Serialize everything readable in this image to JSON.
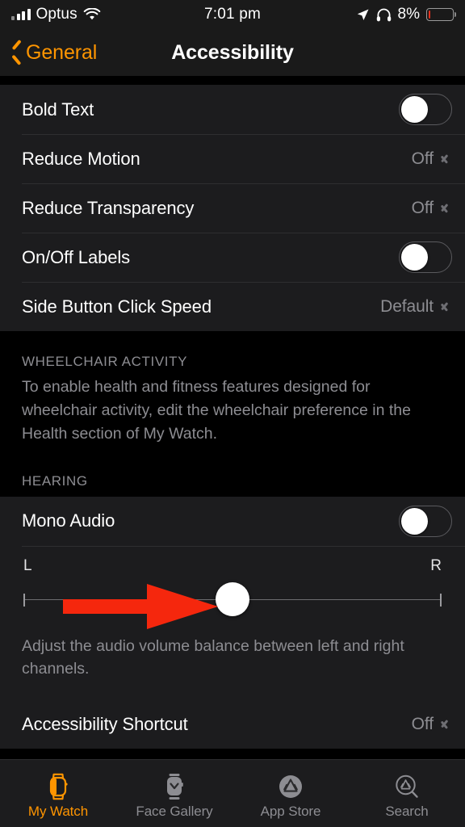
{
  "status_bar": {
    "carrier": "Optus",
    "wifi_icon": "wifi-icon",
    "signal_icon": "cellular-signal-icon",
    "time": "7:01 pm",
    "location_icon": "location-arrow-icon",
    "headphones_icon": "headphones-icon",
    "battery_percent": "8%",
    "battery_level": 8,
    "battery_color": "#e8301c"
  },
  "nav_bar": {
    "back_label": "General",
    "back_icon": "chevron-left-icon",
    "title": "Accessibility",
    "accent_color": "#ff9500"
  },
  "vision_group": {
    "rows": [
      {
        "label": "Bold Text",
        "control": "toggle",
        "value": "Off"
      },
      {
        "label": "Reduce Motion",
        "control": "disclosure",
        "value": "Off"
      },
      {
        "label": "Reduce Transparency",
        "control": "disclosure",
        "value": "Off"
      },
      {
        "label": "On/Off Labels",
        "control": "toggle",
        "value": "Off"
      },
      {
        "label": "Side Button Click Speed",
        "control": "disclosure",
        "value": "Default"
      }
    ]
  },
  "wheelchair_section": {
    "header": "WHEELCHAIR ACTIVITY",
    "note": "To enable health and fitness features designed for wheelchair activity, edit the wheelchair preference in the Health section of My Watch."
  },
  "hearing_section": {
    "header": "HEARING",
    "mono_audio": {
      "label": "Mono Audio",
      "control": "toggle",
      "value": "Off"
    },
    "balance": {
      "left_label": "L",
      "right_label": "R",
      "value": 50,
      "min": 0,
      "max": 100
    },
    "note": "Adjust the audio volume balance between left and right channels."
  },
  "shortcut_group": {
    "rows": [
      {
        "label": "Accessibility Shortcut",
        "control": "disclosure",
        "value": "Off"
      }
    ]
  },
  "annotation": {
    "type": "arrow",
    "color": "#f5270d",
    "points_to": "audio-balance-slider-thumb",
    "direction": "right"
  },
  "tab_bar": {
    "tabs": [
      {
        "label": "My Watch",
        "icon": "watch-icon",
        "active": true
      },
      {
        "label": "Face Gallery",
        "icon": "watch-face-icon",
        "active": false
      },
      {
        "label": "App Store",
        "icon": "app-store-icon",
        "active": false
      },
      {
        "label": "Search",
        "icon": "app-store-search-icon",
        "active": false
      }
    ],
    "active_color": "#ff9500",
    "inactive_color": "#8d8d92"
  }
}
